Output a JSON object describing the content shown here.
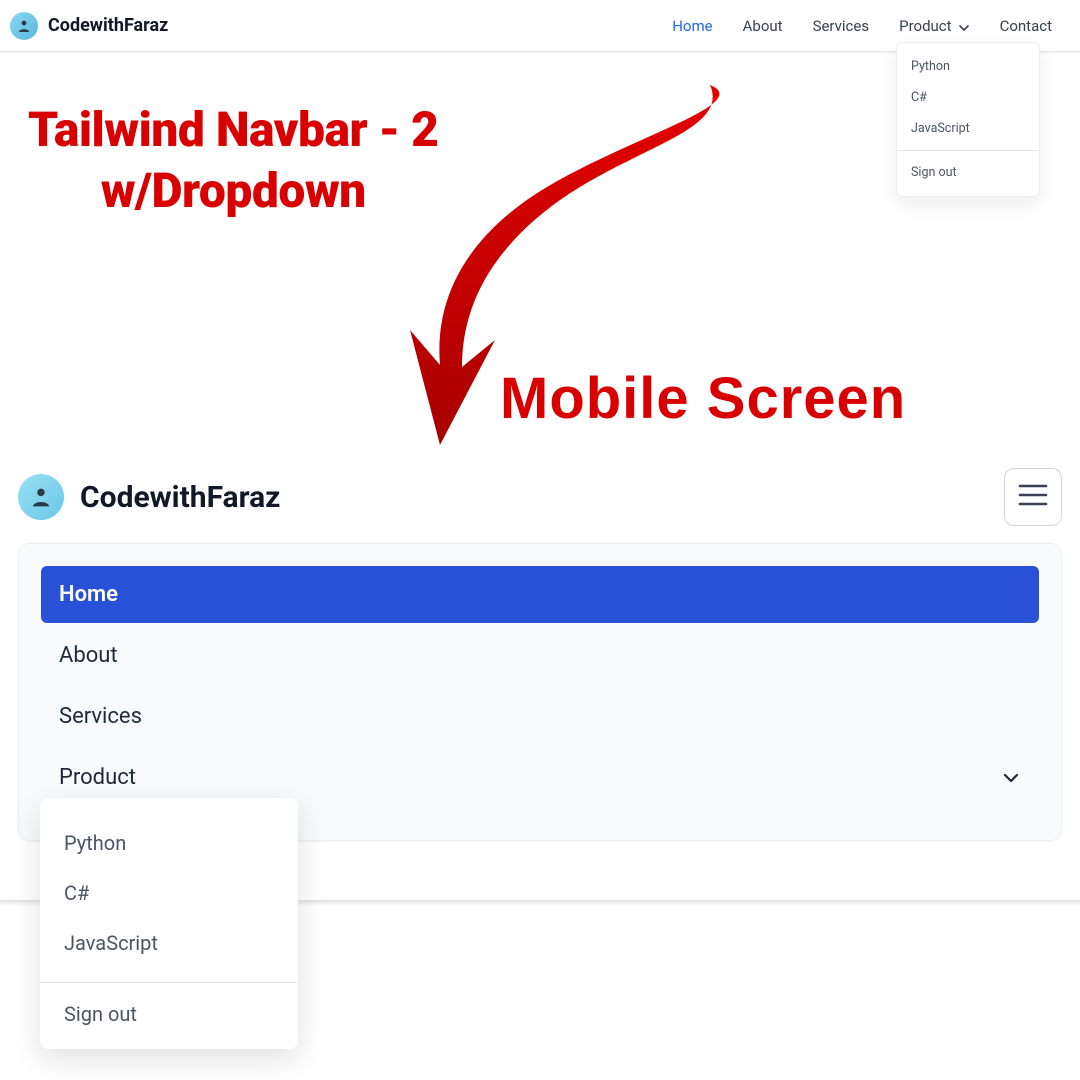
{
  "brand": "CodewithFaraz",
  "colors": {
    "accent": "#2563eb",
    "annotation": "#d80000",
    "active_bg": "#2851d8"
  },
  "desktop": {
    "nav": [
      {
        "label": "Home",
        "active": true
      },
      {
        "label": "About"
      },
      {
        "label": "Services"
      },
      {
        "label": "Product",
        "has_dropdown": true
      },
      {
        "label": "Contact"
      }
    ],
    "dropdown": {
      "items": [
        "Python",
        "C#",
        "JavaScript"
      ],
      "footer": "Sign out"
    }
  },
  "annotations": {
    "title_line1": "Tailwind Navbar - 2",
    "title_line2": "w/Dropdown",
    "mobile_label": "Mobile Screen"
  },
  "mobile": {
    "items": [
      {
        "label": "Home",
        "active": true
      },
      {
        "label": "About"
      },
      {
        "label": "Services"
      },
      {
        "label": "Product",
        "has_dropdown": true
      }
    ],
    "dropdown": {
      "items": [
        "Python",
        "C#",
        "JavaScript"
      ],
      "footer": "Sign out"
    }
  }
}
